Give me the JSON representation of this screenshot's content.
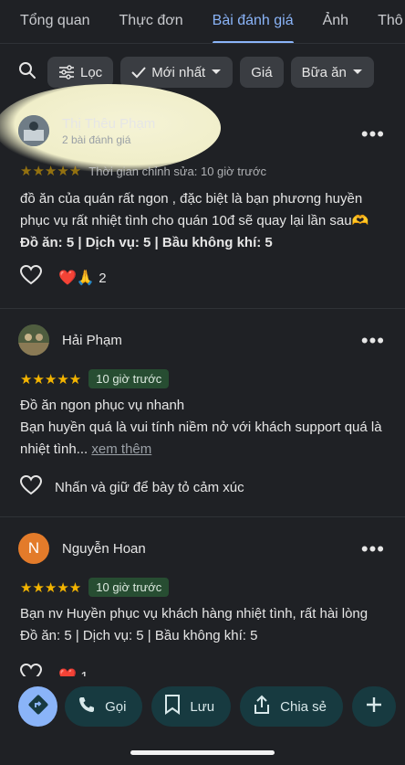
{
  "tabs": [
    "Tổng quan",
    "Thực đơn",
    "Bài đánh giá",
    "Ảnh",
    "Thô"
  ],
  "active_tab": "Bài đánh giá",
  "filters": {
    "filter_label": "Lọc",
    "sort_label": "Mới nhất",
    "price_label": "Giá",
    "meal_label": "Bữa ăn"
  },
  "reviews": [
    {
      "name": "Thị Thêu Phạm",
      "subtitle": "2 bài đánh giá",
      "stars": 5,
      "time": "Thời gian chỉnh sửa: 10 giờ trước",
      "text": "đồ ăn của quán rất ngon , đặc biệt là bạn phương huyền phục vụ rất nhiệt tình cho quán 10đ sẽ quay lại lần sau🫶",
      "details": "Đồ ăn: 5 | Dịch vụ: 5 | Bầu không khí: 5",
      "reactions": "❤️🙏",
      "reaction_count": "2"
    },
    {
      "name": "Hải Phạm",
      "stars": 5,
      "time": "10 giờ trước",
      "text_line1": "Đồ ăn ngon phục vụ nhanh",
      "text_line2": "Bạn huyền quá là vui tính niềm nở với khách support quá là nhiệt tình...",
      "more_link": "xem thêm",
      "react_hint": "Nhấn và giữ để bày tỏ cảm xúc"
    },
    {
      "name": "Nguyễn Hoan",
      "avatar_letter": "N",
      "stars": 5,
      "time": "10 giờ trước",
      "text": "Bạn nv Huyền phục vụ khách hàng nhiệt tình, rất hài lòng",
      "details": "Đồ ăn: 5 | Dịch vụ: 5 | Bầu không khí: 5",
      "reactions": "❤️",
      "reaction_count": "1"
    }
  ],
  "actions": {
    "call": "Gọi",
    "save": "Lưu",
    "share": "Chia sẻ"
  },
  "icons": [
    "search-icon",
    "filter-icon",
    "check-icon",
    "chevron-down-icon",
    "heart-icon",
    "directions-icon",
    "phone-icon",
    "bookmark-icon",
    "share-icon",
    "plus-icon"
  ],
  "colors": {
    "accent": "#8ab4f8",
    "star": "#f3b400",
    "badge": "#274d32",
    "action_bg": "#173a40"
  }
}
